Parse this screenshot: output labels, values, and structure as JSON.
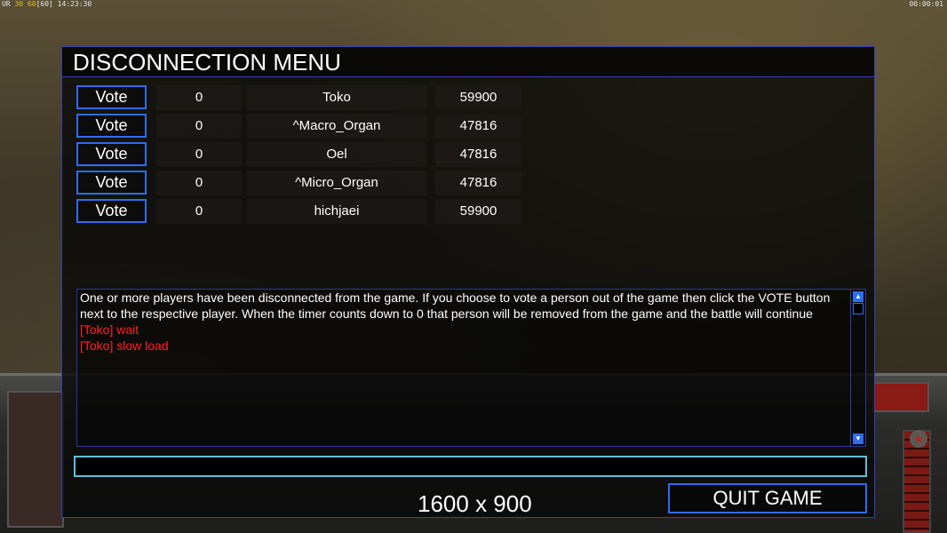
{
  "hud": {
    "top_left_prefix": "UR",
    "top_left_fps": "30 60",
    "top_left_bracket": "[60]",
    "top_left_time": "14:23:30",
    "top_right_timer": "00:00:01"
  },
  "dialog": {
    "title": "DISCONNECTION MENU",
    "players": [
      {
        "vote_label": "Vote",
        "count": "0",
        "name": "Toko",
        "value": "59900"
      },
      {
        "vote_label": "Vote",
        "count": "0",
        "name": "^Macro_Organ",
        "value": "47816"
      },
      {
        "vote_label": "Vote",
        "count": "0",
        "name": "Oel",
        "value": "47816"
      },
      {
        "vote_label": "Vote",
        "count": "0",
        "name": "^Micro_Organ",
        "value": "47816"
      },
      {
        "vote_label": "Vote",
        "count": "0",
        "name": "hichjaei",
        "value": "59900"
      }
    ],
    "chat": {
      "info": "One or more players have been disconnected from the game. If you choose to vote a person out of the game then click the VOTE button next to the respective player. When the timer counts down to 0 that person will be removed from the game and the battle will continue",
      "messages": [
        "[Toko] wait",
        "[Toko] slow load"
      ],
      "input_value": ""
    },
    "resolution_text": "1600 x 900",
    "quit_label": "QUIT GAME"
  },
  "colors": {
    "border_blue": "#2f6cf0",
    "chat_red": "#ff2020",
    "input_border": "#5fc0d8"
  }
}
